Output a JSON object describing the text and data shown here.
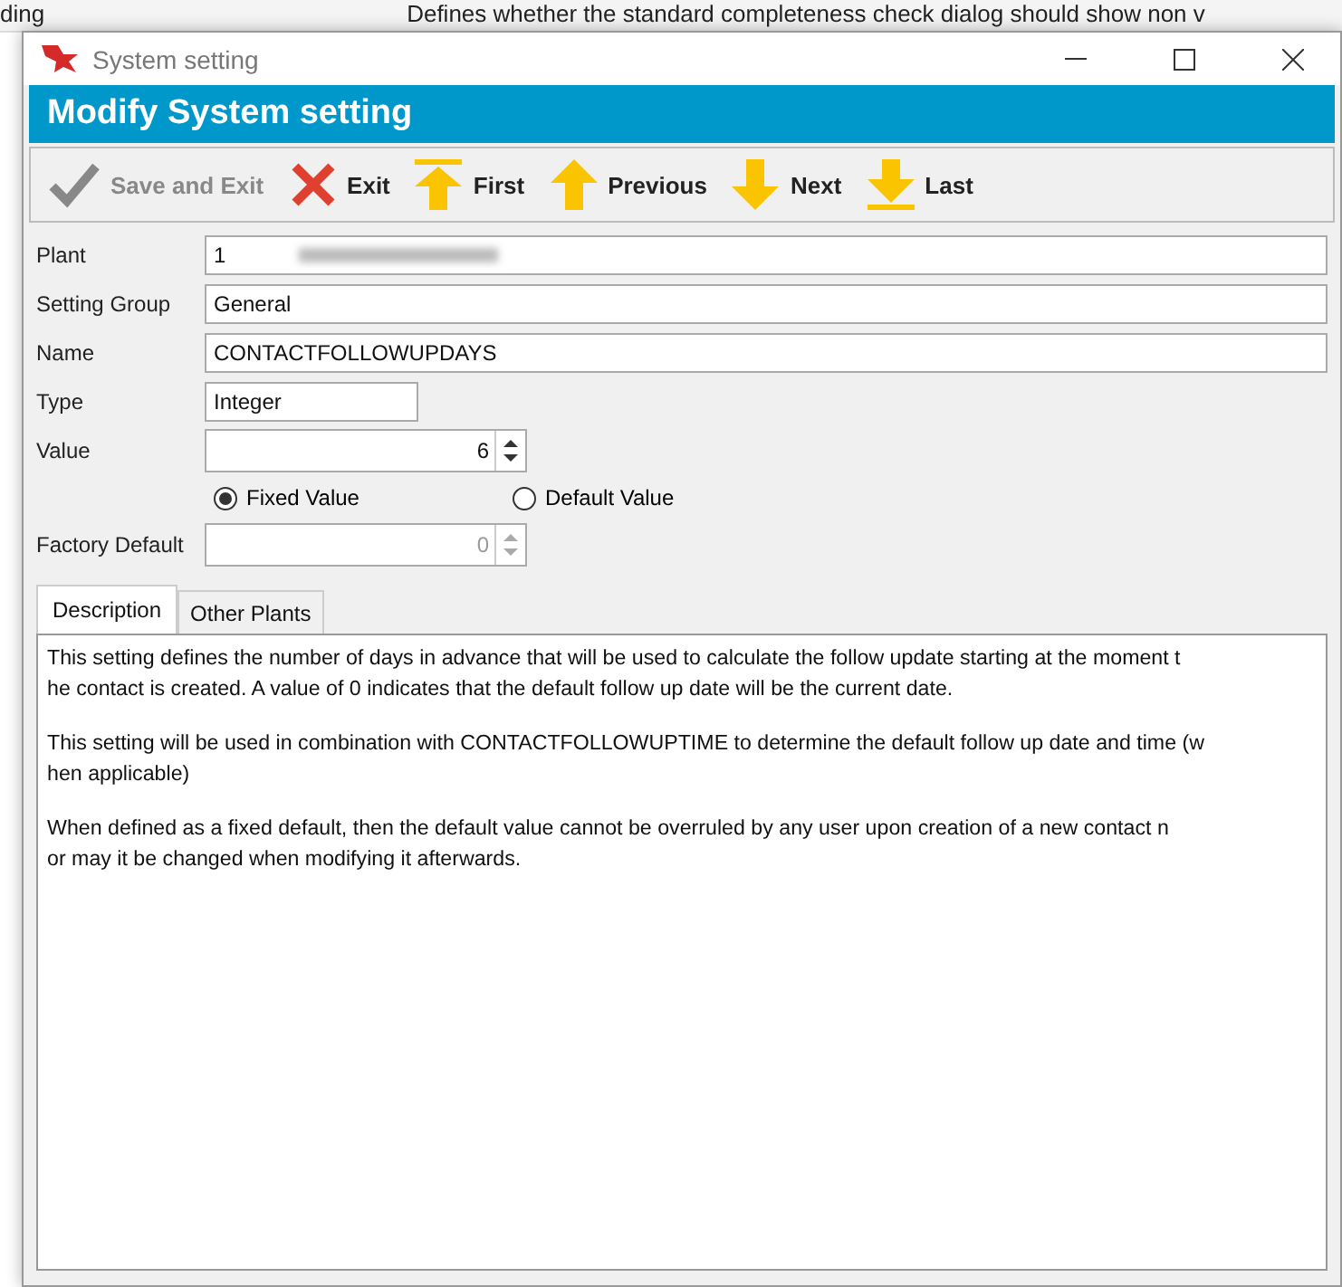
{
  "background": {
    "cell_1": "ding",
    "cell_2": "Defines whether the standard completeness check dialog should show non v"
  },
  "window": {
    "title": "System setting"
  },
  "header": {
    "title": "Modify System setting"
  },
  "toolbar": [
    {
      "label": "Save and Exit",
      "kind": "check",
      "disabled": true
    },
    {
      "label": "Exit",
      "kind": "cross",
      "disabled": false
    },
    {
      "label": "First",
      "kind": "first",
      "disabled": false
    },
    {
      "label": "Previous",
      "kind": "up",
      "disabled": false
    },
    {
      "label": "Next",
      "kind": "down",
      "disabled": false
    },
    {
      "label": "Last",
      "kind": "last",
      "disabled": false
    }
  ],
  "form": {
    "plant": {
      "label": "Plant",
      "value": "1"
    },
    "setting_group": {
      "label": "Setting Group",
      "value": "General"
    },
    "name": {
      "label": "Name",
      "value": "CONTACTFOLLOWUPDAYS"
    },
    "type": {
      "label": "Type",
      "value": "Integer"
    },
    "value": {
      "label": "Value",
      "value": "6",
      "disabled": false
    },
    "options": [
      {
        "label": "Fixed Value",
        "selected": true
      },
      {
        "label": "Default Value",
        "selected": false
      }
    ],
    "factory_default": {
      "label": "Factory Default",
      "value": "0",
      "disabled": true
    }
  },
  "tabs": [
    {
      "label": "Description",
      "selected": true
    },
    {
      "label": "Other Plants",
      "selected": false
    }
  ],
  "description": [
    [
      "This setting defines the number of days in advance that will be used to calculate the follow update starting at the moment t",
      "he contact is created. A value of 0 indicates that the default follow up date will be the current date."
    ],
    [
      "This setting will be used in combination with CONTACTFOLLOWUPTIME to determine the default follow up date and time (w",
      "hen applicable)"
    ],
    [
      "When defined as a fixed default, then the default value cannot be overruled by any user upon creation of a new contact n",
      "or may it be changed when modifying it afterwards."
    ]
  ]
}
